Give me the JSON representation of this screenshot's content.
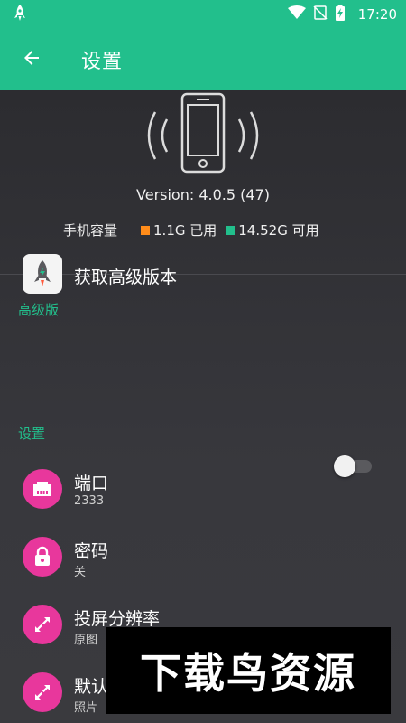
{
  "status_bar": {
    "time": "17:20",
    "icons": [
      "rocket-icon",
      "wifi-icon",
      "no-sim-icon",
      "battery-charging-icon"
    ]
  },
  "toolbar": {
    "back_icon": "arrow-left-icon",
    "title": "设置"
  },
  "device": {
    "icon": "phone-vibrate-icon",
    "version": "Version: 4.0.5 (47)",
    "storage_label": "手机容量",
    "used": "1.1G 已用",
    "free": "14.52G 可用",
    "used_color": "#ff8c1a",
    "free_color": "#22bf8c"
  },
  "sections": {
    "premium_header": "高级版",
    "premium_item": "获取高级版本",
    "settings_header": "设置"
  },
  "settings_items": [
    {
      "title": "端口",
      "subtitle": "2333",
      "icon": "ethernet-port-icon"
    },
    {
      "title": "密码",
      "subtitle": "关",
      "icon": "lock-icon",
      "toggle_on": false
    },
    {
      "title": "投屏分辨率",
      "subtitle": "原图",
      "icon": "expand-arrows-icon"
    },
    {
      "title": "默认",
      "subtitle": "照片",
      "icon": "expand-arrows-icon"
    }
  ],
  "colors": {
    "accent": "#22bf8c",
    "icon_circle": "#e8379c",
    "background": "#2b2b2e"
  },
  "watermark": "下载鸟资源"
}
